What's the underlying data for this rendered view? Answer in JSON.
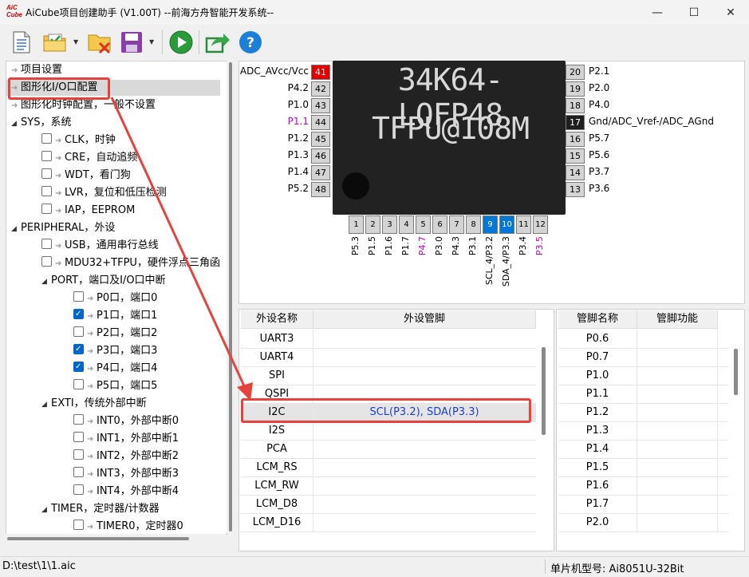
{
  "window": {
    "logo_text": "AiC Cube",
    "title": "AiCube项目创建助手 (V1.00T) --前海方舟智能开发系统--",
    "controls": [
      "—",
      "☐",
      "✕"
    ]
  },
  "toolbar": {
    "buttons": [
      "new-document",
      "open-project",
      "close-project",
      "save",
      "run",
      "export",
      "help"
    ]
  },
  "tree": {
    "nodes": [
      {
        "level": 0,
        "kind": "arrow",
        "label": "项目设置"
      },
      {
        "level": 0,
        "kind": "arrow",
        "label": "图形化I/O口配置",
        "selected": true
      },
      {
        "level": 0,
        "kind": "arrow",
        "label": "图形化时钟配置，一般不设置"
      },
      {
        "level": 0,
        "kind": "expand",
        "label": "SYS，系统"
      },
      {
        "level": 1,
        "kind": "check",
        "checked": false,
        "label": "CLK，时钟"
      },
      {
        "level": 1,
        "kind": "check",
        "checked": false,
        "label": "CRE，自动追频"
      },
      {
        "level": 1,
        "kind": "check",
        "checked": false,
        "label": "WDT，看门狗"
      },
      {
        "level": 1,
        "kind": "check",
        "checked": false,
        "label": "LVR，复位和低压检测"
      },
      {
        "level": 1,
        "kind": "check",
        "checked": false,
        "label": "IAP，EEPROM"
      },
      {
        "level": 0,
        "kind": "expand",
        "label": "PERIPHERAL，外设"
      },
      {
        "level": 1,
        "kind": "check",
        "checked": false,
        "label": "USB，通用串行总线"
      },
      {
        "level": 1,
        "kind": "check",
        "checked": false,
        "label": "MDU32+TFPU，硬件浮点三角函"
      },
      {
        "level": 1,
        "kind": "expand",
        "label": "PORT，端口及I/O口中断"
      },
      {
        "level": 2,
        "kind": "check",
        "checked": false,
        "label": "P0口，端口0"
      },
      {
        "level": 2,
        "kind": "check",
        "checked": true,
        "label": "P1口，端口1"
      },
      {
        "level": 2,
        "kind": "check",
        "checked": false,
        "label": "P2口，端口2"
      },
      {
        "level": 2,
        "kind": "check",
        "checked": true,
        "label": "P3口，端口3"
      },
      {
        "level": 2,
        "kind": "check",
        "checked": true,
        "label": "P4口，端口4"
      },
      {
        "level": 2,
        "kind": "check",
        "checked": false,
        "label": "P5口，端口5"
      },
      {
        "level": 1,
        "kind": "expand",
        "label": "EXTI，传统外部中断"
      },
      {
        "level": 2,
        "kind": "check",
        "checked": false,
        "label": "INT0，外部中断0"
      },
      {
        "level": 2,
        "kind": "check",
        "checked": false,
        "label": "INT1，外部中断1"
      },
      {
        "level": 2,
        "kind": "check",
        "checked": false,
        "label": "INT2，外部中断2"
      },
      {
        "level": 2,
        "kind": "check",
        "checked": false,
        "label": "INT3，外部中断3"
      },
      {
        "level": 2,
        "kind": "check",
        "checked": false,
        "label": "INT4，外部中断4"
      },
      {
        "level": 1,
        "kind": "expand",
        "label": "TIMER，定时器/计数器"
      },
      {
        "level": 2,
        "kind": "check",
        "checked": false,
        "label": "TIMER0，定时器0"
      }
    ]
  },
  "chip": {
    "marking_line1": "34K64-LQFP48",
    "marking_line2": "TFPU@108M",
    "left_pins": [
      {
        "label": "ADC_AVcc/Vcc",
        "num": "41",
        "style": "power"
      },
      {
        "label": "P4.2",
        "num": "42"
      },
      {
        "label": "P1.0",
        "num": "43"
      },
      {
        "label": "P1.1",
        "num": "44",
        "highlight": true
      },
      {
        "label": "P1.2",
        "num": "45"
      },
      {
        "label": "P1.3",
        "num": "46"
      },
      {
        "label": "P1.4",
        "num": "47"
      },
      {
        "label": "P5.2",
        "num": "48"
      }
    ],
    "right_pins": [
      {
        "label": "P2.1",
        "num": "20"
      },
      {
        "label": "P2.0",
        "num": "19"
      },
      {
        "label": "P4.0",
        "num": "18"
      },
      {
        "label": "Gnd/ADC_Vref-/ADC_AGnd",
        "num": "17",
        "style": "gnd"
      },
      {
        "label": "P5.7",
        "num": "16"
      },
      {
        "label": "P5.6",
        "num": "15"
      },
      {
        "label": "P3.7",
        "num": "14"
      },
      {
        "label": "P3.6",
        "num": "13"
      }
    ],
    "bottom_pins": [
      {
        "num": "1",
        "label": "P5.3"
      },
      {
        "num": "2",
        "label": "P1.5"
      },
      {
        "num": "3",
        "label": "P1.6"
      },
      {
        "num": "4",
        "label": "P1.7"
      },
      {
        "num": "5",
        "label": "P4.7",
        "highlight": true
      },
      {
        "num": "6",
        "label": "P3.0"
      },
      {
        "num": "7",
        "label": "P4.3"
      },
      {
        "num": "8",
        "label": "P3.1"
      },
      {
        "num": "9",
        "label": "SCL_4/P3.2",
        "style": "active"
      },
      {
        "num": "10",
        "label": "SDA_4/P3.3",
        "style": "active"
      },
      {
        "num": "11",
        "label": "P3.4"
      },
      {
        "num": "12",
        "label": "P3.5",
        "highlight": true
      }
    ]
  },
  "peripheral_table": {
    "headers": [
      "外设名称",
      "外设管脚"
    ],
    "rows": [
      {
        "name": "UART3",
        "pins": ""
      },
      {
        "name": "UART4",
        "pins": ""
      },
      {
        "name": "SPI",
        "pins": ""
      },
      {
        "name": "QSPI",
        "pins": ""
      },
      {
        "name": "I2C",
        "pins": "SCL(P3.2), SDA(P3.3)",
        "selected": true
      },
      {
        "name": "I2S",
        "pins": ""
      },
      {
        "name": "PCA",
        "pins": ""
      },
      {
        "name": "LCM_RS",
        "pins": ""
      },
      {
        "name": "LCM_RW",
        "pins": ""
      },
      {
        "name": "LCM_D8",
        "pins": ""
      },
      {
        "name": "LCM_D16",
        "pins": ""
      }
    ]
  },
  "pin_table": {
    "headers": [
      "管脚名称",
      "管脚功能"
    ],
    "rows": [
      "P0.6",
      "P0.7",
      "P1.0",
      "P1.1",
      "P1.2",
      "P1.3",
      "P1.4",
      "P1.5",
      "P1.6",
      "P1.7",
      "P2.0"
    ]
  },
  "status": {
    "file_path": "D:\\test\\1\\1.aic",
    "mcu_model": "单片机型号:  Ai8051U-32Bit"
  },
  "colors": {
    "annotation_red": "#e8423d",
    "active_blue": "#0078d7",
    "highlight_magenta": "#cc00cc",
    "power_red": "#e00000"
  }
}
